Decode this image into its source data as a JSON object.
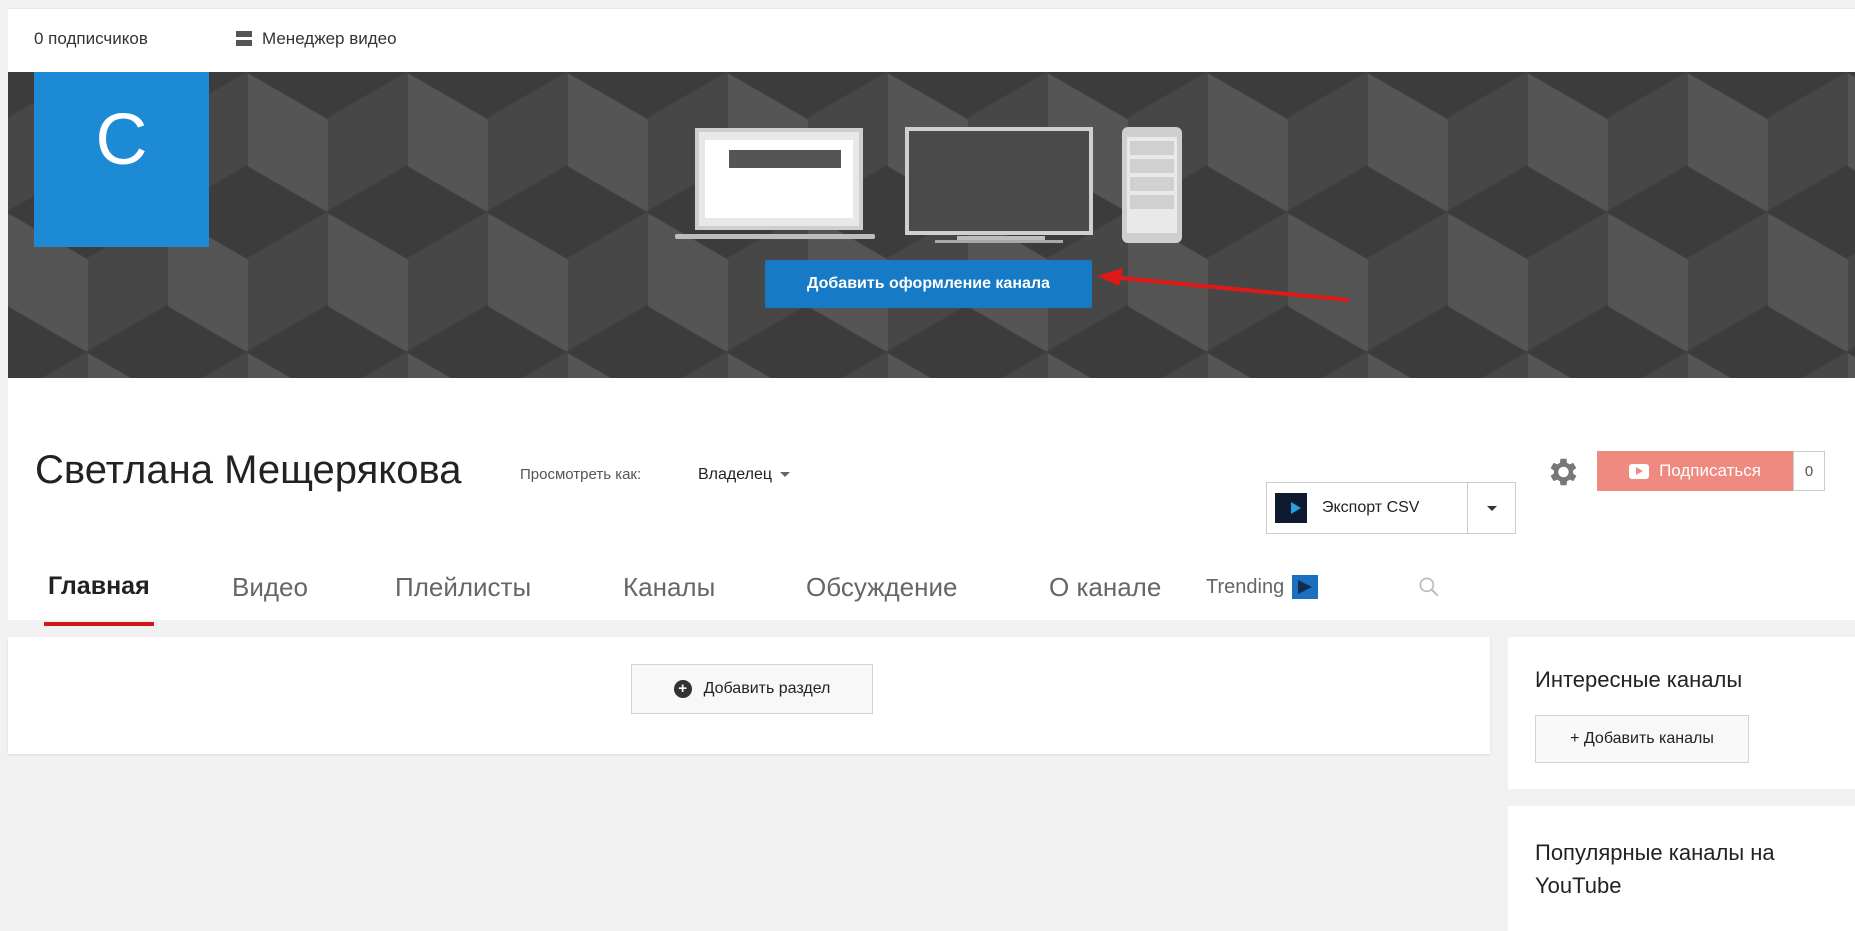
{
  "topbar": {
    "subscribers": "0 подписчиков",
    "video_manager": "Менеджер видео"
  },
  "banner": {
    "avatar_letter": "C",
    "add_art_label": "Добавить оформление канала",
    "avatar_color": "#1c8ad4",
    "button_color": "#167ac6"
  },
  "channel": {
    "name": "Светлана Мещерякова",
    "view_as_label": "Просмотреть как:",
    "view_as_value": "Владелец",
    "export_label": "Экспорт CSV",
    "subscribe_label": "Подписаться",
    "subscribe_count": "0",
    "subscribe_color": "#ef8a80"
  },
  "tabs": [
    {
      "label": "Главная",
      "active": true
    },
    {
      "label": "Видео"
    },
    {
      "label": "Плейлисты"
    },
    {
      "label": "Каналы"
    },
    {
      "label": "Обсуждение"
    },
    {
      "label": "О канале"
    },
    {
      "label": "Trending"
    }
  ],
  "main": {
    "add_section_label": "Добавить раздел"
  },
  "sidebar": {
    "featured_title": "Интересные каналы",
    "add_channels_label": "+ Добавить каналы",
    "popular_title": "Популярные каналы на YouTube"
  },
  "icons": {
    "video_manager": "video-manager-icon",
    "gear": "gear-icon",
    "search": "search-icon",
    "trending": "trending-icon",
    "export_logo": "export-logo-icon",
    "plus_circle": "plus-circle-icon",
    "arrow": "red-arrow-annotation"
  }
}
